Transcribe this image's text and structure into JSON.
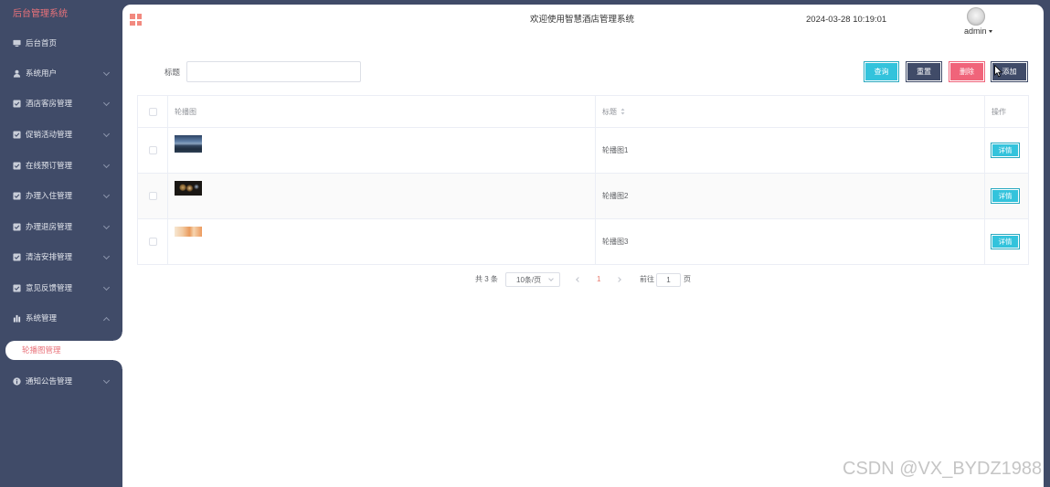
{
  "theme": {
    "sidebar_bg": "#404b68",
    "accent": "#e9727a",
    "primary": "#33c3dc",
    "danger": "#f0647a",
    "dark_button": "#404b68"
  },
  "sidebar": {
    "title": "后台管理系统",
    "items": [
      {
        "label": "后台首页",
        "icon": "monitor-icon"
      },
      {
        "label": "系统用户",
        "icon": "user-icon",
        "state": "collapsed"
      },
      {
        "label": "酒店客房管理",
        "icon": "checkbox-icon",
        "state": "collapsed"
      },
      {
        "label": "促销活动管理",
        "icon": "checkbox-icon",
        "state": "collapsed"
      },
      {
        "label": "在线预订管理",
        "icon": "checkbox-icon",
        "state": "collapsed"
      },
      {
        "label": "办理入住管理",
        "icon": "checkbox-icon",
        "state": "collapsed"
      },
      {
        "label": "办理退房管理",
        "icon": "checkbox-icon",
        "state": "collapsed"
      },
      {
        "label": "清洁安排管理",
        "icon": "checkbox-icon",
        "state": "collapsed"
      },
      {
        "label": "意见反馈管理",
        "icon": "checkbox-icon",
        "state": "collapsed"
      },
      {
        "label": "系统管理",
        "icon": "bar-chart-icon",
        "state": "expanded",
        "children": [
          {
            "label": "轮播图管理",
            "active": true
          }
        ]
      },
      {
        "label": "通知公告管理",
        "icon": "info-icon",
        "state": "collapsed"
      }
    ]
  },
  "header": {
    "menu_icon": "grid-icon",
    "welcome": "欢迎使用智慧酒店管理系统",
    "datetime": "2024-03-28 10:19:01",
    "user": "admin"
  },
  "search": {
    "label": "标题",
    "value": ""
  },
  "toolbar": {
    "query": "查询",
    "reset": "重置",
    "delete": "删除",
    "add": "添加"
  },
  "table": {
    "headers": {
      "image": "轮播图",
      "title": "标题",
      "action": "操作"
    },
    "sortable": "title",
    "rows": [
      {
        "title": "轮播图1",
        "action": "详情"
      },
      {
        "title": "轮播图2",
        "action": "详情"
      },
      {
        "title": "轮播图3",
        "action": "详情"
      }
    ]
  },
  "pagination": {
    "total": "共 3 条",
    "page_size": "10条/页",
    "current_page": "1",
    "goto_label": "前往",
    "goto_value": "1",
    "page_unit": "页"
  },
  "watermark": "CSDN @VX_BYDZ1988"
}
